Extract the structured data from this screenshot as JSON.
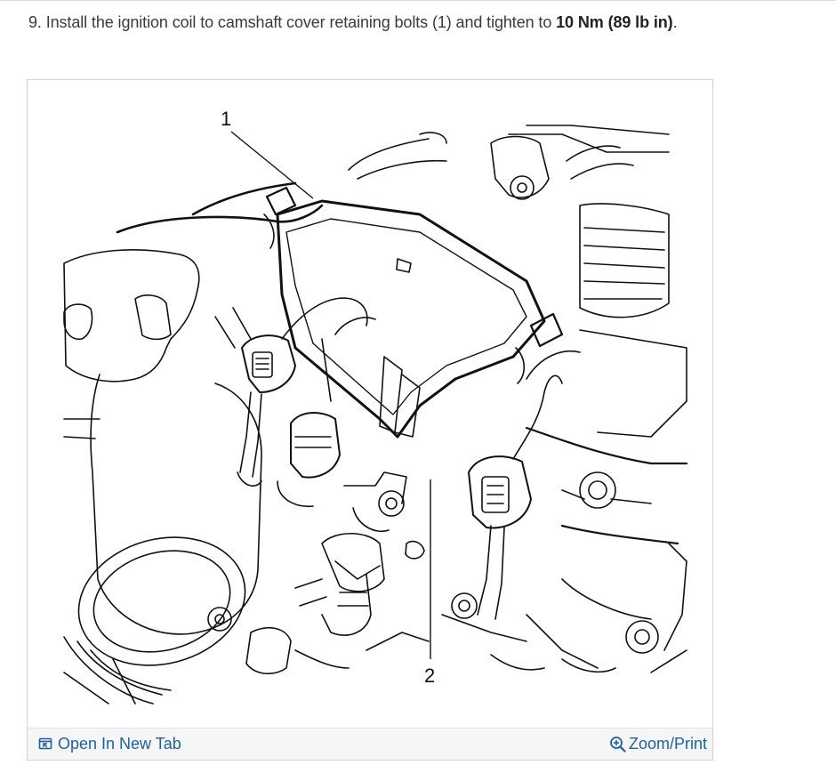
{
  "instruction": {
    "prefix": "9. Install the ignition coil to camshaft cover retaining bolts (1) and tighten to ",
    "torque_value": "10 Nm (89 lb in)",
    "suffix": "."
  },
  "figure": {
    "callouts": [
      "1",
      "2"
    ]
  },
  "footer": {
    "open_tab_label": "Open In New Tab",
    "zoom_label": "Zoom/Print",
    "open_tab_icon": "open-new-tab-icon",
    "zoom_icon": "zoom-in-icon"
  },
  "colors": {
    "link": "#1f5fa8",
    "footer_bg": "#f5f6f8"
  }
}
